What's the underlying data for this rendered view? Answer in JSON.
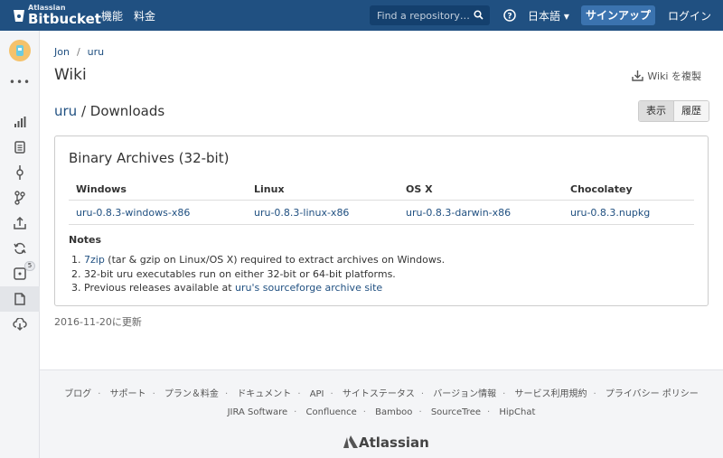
{
  "topbar": {
    "logo_small": "Atlassian",
    "logo_big": "Bitbucket",
    "nav": [
      "機能",
      "料金"
    ],
    "search_placeholder": "Find a repository…",
    "language": "日本語 ▾",
    "signup": "サインアップ",
    "login": "ログイン"
  },
  "sidebar": {
    "more": "•••",
    "badge": "5"
  },
  "breadcrumb": [
    "Jon",
    "uru"
  ],
  "page_title": "Wiki",
  "clone_label": "Wiki を複製",
  "subtitle": {
    "repo": "uru",
    "rest": " / Downloads"
  },
  "view_toggle": [
    "表示",
    "履歴"
  ],
  "card": {
    "title": "Binary Archives (32-bit)",
    "headers": [
      "Windows",
      "Linux",
      "OS X",
      "Chocolatey"
    ],
    "files": [
      "uru-0.8.3-windows-x86",
      "uru-0.8.3-linux-x86",
      "uru-0.8.3-darwin-x86",
      "uru-0.8.3.nupkg"
    ],
    "notes_title": "Notes",
    "notes": {
      "n1_link": "7zip",
      "n1_rest": " (tar & gzip on Linux/OS X) required to extract archives on Windows.",
      "n2": "32-bit uru executables run on either 32-bit or 64-bit platforms.",
      "n3_text": "Previous releases available at ",
      "n3_link": "uru's sourceforge archive site"
    }
  },
  "updated": "2016-11-20に更新",
  "footer": {
    "row1": [
      "ブログ",
      "サポート",
      "プラン＆料金",
      "ドキュメント",
      "API",
      "サイトステータス",
      "バージョン情報",
      "サービス利用規約",
      "プライバシー ポリシー"
    ],
    "row2": [
      "JIRA Software",
      "Confluence",
      "Bamboo",
      "SourceTree",
      "HipChat"
    ],
    "brand": "Atlassian"
  },
  "colors": {
    "header": "#205081",
    "link": "#205081",
    "signup": "#3b73af"
  }
}
